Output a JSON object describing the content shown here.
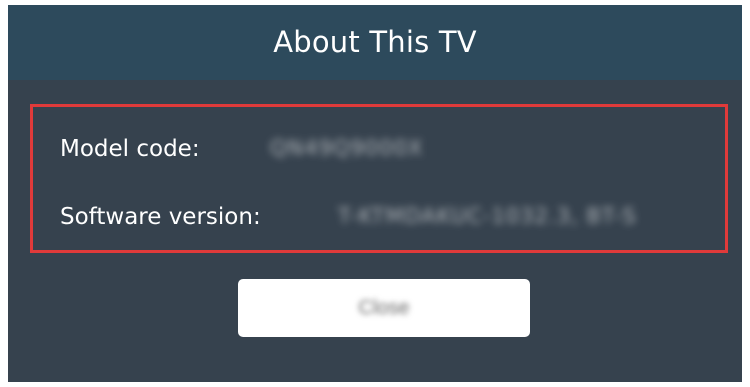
{
  "dialog": {
    "title": "About This TV",
    "rows": [
      {
        "label": "Model code:",
        "value": "QN49Q9000X"
      },
      {
        "label": "Software version:",
        "value": "T-KTMDAKUC-1032.3, BT-S"
      }
    ],
    "close_label": "Close",
    "colors": {
      "title_bar": "#2d4a5c",
      "body": "#36424e",
      "highlight_border": "#e03a3a",
      "button_bg": "#ffffff"
    }
  }
}
